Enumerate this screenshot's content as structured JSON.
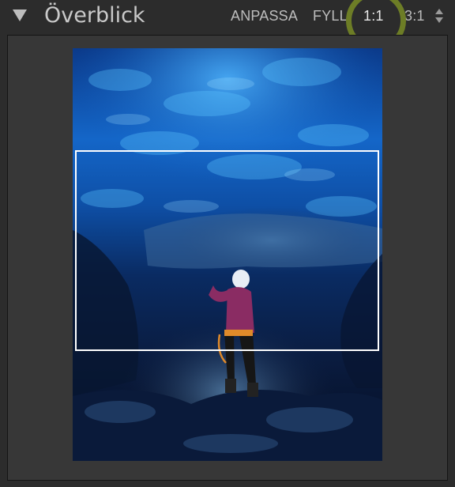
{
  "panel": {
    "title": "Överblick",
    "zoom_options": [
      {
        "label": "ANPASSA",
        "active": false
      },
      {
        "label": "FYLL",
        "active": false
      },
      {
        "label": "1:1",
        "active": true
      },
      {
        "label": "3:1",
        "active": false
      }
    ],
    "highlight_color": "#6d7d26",
    "stepper_icon": "up-down-stepper-icon",
    "collapse_icon": "triangle-down-icon"
  },
  "preview": {
    "subject": "ice cave photo",
    "accent_color": "#1d6fd6"
  }
}
